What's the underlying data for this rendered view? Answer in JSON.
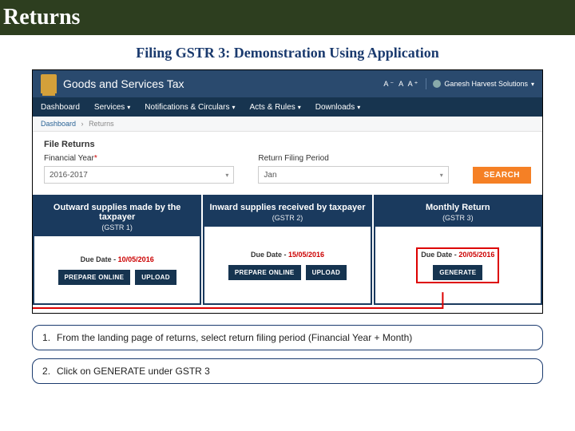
{
  "title_bar": {
    "title": "Returns"
  },
  "subtitle": "Filing GSTR 3: Demonstration Using Application",
  "app": {
    "header": {
      "title": "Goods and Services Tax",
      "font_sizer": "A⁻  A  A⁺",
      "user": "Ganesh Harvest Solutions"
    },
    "nav": {
      "dashboard": "Dashboard",
      "services": "Services",
      "notifications": "Notifications & Circulars",
      "acts": "Acts & Rules",
      "downloads": "Downloads"
    },
    "breadcrumb": {
      "root": "Dashboard",
      "current": "Returns"
    },
    "body": {
      "heading": "File Returns",
      "fy_label": "Financial Year",
      "fy_value": "2016-2017",
      "period_label": "Return Filing Period",
      "period_value": "Jan",
      "search": "SEARCH"
    },
    "cards": [
      {
        "title": "Outward supplies made by the taxpayer",
        "sub": "(GSTR 1)",
        "due_label": "Due Date -",
        "due_date": "10/05/2016",
        "btn1": "PREPARE ONLINE",
        "btn2": "UPLOAD"
      },
      {
        "title": "Inward supplies received by taxpayer",
        "sub": "(GSTR 2)",
        "due_label": "Due Date -",
        "due_date": "15/05/2016",
        "btn1": "PREPARE ONLINE",
        "btn2": "UPLOAD"
      },
      {
        "title": "Monthly Return",
        "sub": "(GSTR 3)",
        "due_label": "Due Date -",
        "due_date": "20/05/2016",
        "btn_generate": "GENERATE"
      }
    ]
  },
  "steps": [
    {
      "n": "1",
      "text": "From the landing page of returns, select return filing period (Financial Year + Month)"
    },
    {
      "n": "2",
      "text": "Click on GENERATE under GSTR 3"
    }
  ]
}
